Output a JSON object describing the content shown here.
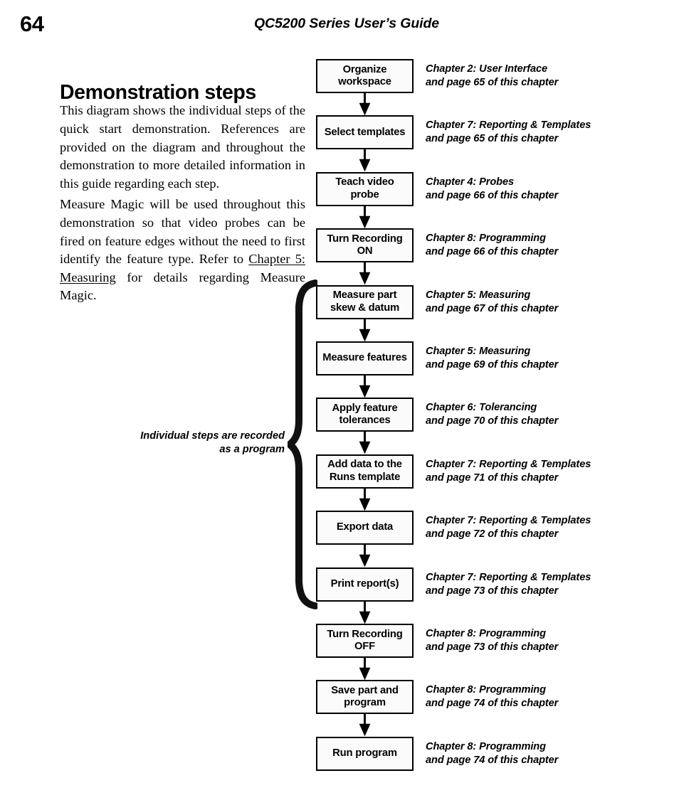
{
  "header": {
    "page_number": "64",
    "running_head": "QC5200 Series User’s Guide"
  },
  "left_column": {
    "section_title": "Demonstration steps",
    "paragraph_1": "This diagram shows the individual steps of the quick start demonstration.  References are provided on the diagram and throughout the demonstration to more detailed information in this guide regarding each step.",
    "paragraph_2_part_1": "Measure Magic will be used throughout this demonstration so that video probes can be fired on feature edges without the need to first identify the feature type.  Refer to ",
    "paragraph_2_link": "Chapter 5:  Measuring",
    "paragraph_2_part_2": " for details regarding Measure Magic."
  },
  "brace_annotation": {
    "line_1": "Individual steps are",
    "line_2": "recorded as a program",
    "spans_steps": [
      "Measure part skew & datum",
      "Print report(s)"
    ]
  },
  "flowchart": {
    "type": "vertical-flow",
    "steps": [
      {
        "label_line_1": "Organize",
        "label_line_2": "workspace",
        "ref_line_1": "Chapter 2:  User Interface",
        "ref_line_2": "and page 65 of this chapter"
      },
      {
        "label_line_1": "Select templates",
        "label_line_2": "",
        "ref_line_1": "Chapter 7:  Reporting & Templates",
        "ref_line_2": "and page 65 of this chapter"
      },
      {
        "label_line_1": "Teach video",
        "label_line_2": "probe",
        "ref_line_1": "Chapter 4:  Probes",
        "ref_line_2": "and page 66 of this chapter"
      },
      {
        "label_line_1": "Turn Recording",
        "label_line_2": "ON",
        "ref_line_1": "Chapter 8:  Programming",
        "ref_line_2": "and page 66 of this chapter"
      },
      {
        "label_line_1": "Measure part",
        "label_line_2": "skew & datum",
        "ref_line_1": "Chapter 5:  Measuring",
        "ref_line_2": "and page 67 of this chapter"
      },
      {
        "label_line_1": "Measure features",
        "label_line_2": "",
        "ref_line_1": "Chapter 5:  Measuring",
        "ref_line_2": "and page 69 of this chapter"
      },
      {
        "label_line_1": "Apply feature",
        "label_line_2": "tolerances",
        "ref_line_1": "Chapter 6:  Tolerancing",
        "ref_line_2": "and page 70 of this chapter"
      },
      {
        "label_line_1": "Add data to the",
        "label_line_2": "Runs template",
        "ref_line_1": "Chapter 7:  Reporting & Templates",
        "ref_line_2": "and page 71 of this chapter"
      },
      {
        "label_line_1": "Export data",
        "label_line_2": "",
        "ref_line_1": "Chapter 7:  Reporting & Templates",
        "ref_line_2": "and page 72 of this chapter"
      },
      {
        "label_line_1": "Print report(s)",
        "label_line_2": "",
        "ref_line_1": "Chapter 7:  Reporting & Templates",
        "ref_line_2": "and page 73 of this chapter"
      },
      {
        "label_line_1": "Turn Recording",
        "label_line_2": "OFF",
        "ref_line_1": "Chapter 8:  Programming",
        "ref_line_2": "and page 73 of this chapter"
      },
      {
        "label_line_1": "Save part and",
        "label_line_2": "program",
        "ref_line_1": "Chapter 8:  Programming",
        "ref_line_2": "and page 74 of this chapter"
      },
      {
        "label_line_1": "Run program",
        "label_line_2": "",
        "ref_line_1": "Chapter 8:  Programming",
        "ref_line_2": "and page 74 of this chapter"
      }
    ]
  },
  "colors": {
    "ink": "#000000",
    "paper": "#ffffff",
    "node_fill": "#fbfbfb"
  }
}
